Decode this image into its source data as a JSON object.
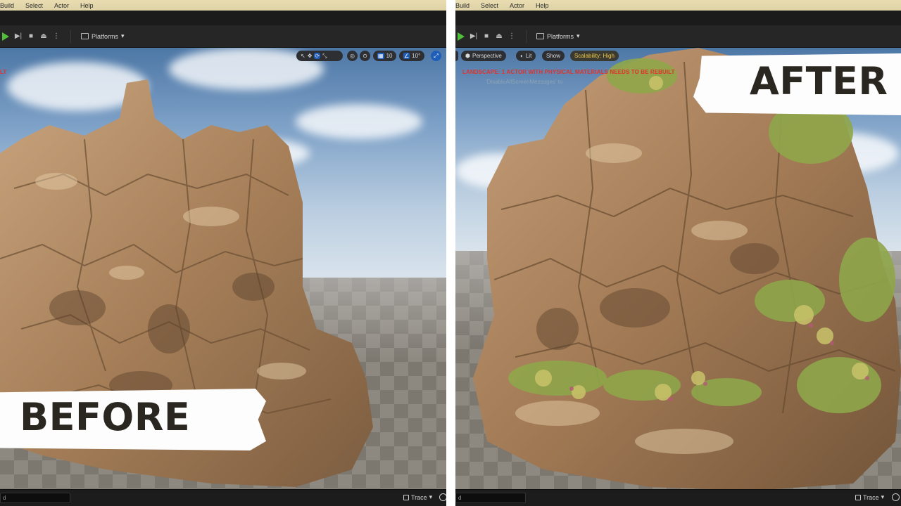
{
  "menu": {
    "items": [
      "Build",
      "Select",
      "Actor",
      "Help"
    ]
  },
  "toolbar": {
    "platforms_label": "Platforms"
  },
  "before_panel": {
    "corner_text": "LT",
    "viewport_controls": {
      "snap_grid": "10",
      "snap_angle": "10°"
    },
    "overlay_label": "BEFORE"
  },
  "after_panel": {
    "viewport_controls": {
      "perspective": "Perspective",
      "lit": "Lit",
      "show": "Show",
      "scalability": "Scalability: High"
    },
    "warning": "LANDSCAPE: 1 ACTOR WITH PHYSICAL MATERIALS NEEDS TO BE REBUILT",
    "message": "'DisableAllScreenMessages' to",
    "overlay_label": "AFTER"
  },
  "statusbar": {
    "command_placeholder": "d",
    "trace_label": "Trace"
  },
  "colors": {
    "menubar": "#e3d8ab",
    "toolbar": "#262626",
    "play_green": "#4fbf3a",
    "accent_blue": "#1f5eb8",
    "warning_red": "#e0322b",
    "scalability_yellow": "#f2c94c",
    "rock_tan": "#b08a63",
    "foliage_green": "#8fa64a"
  }
}
